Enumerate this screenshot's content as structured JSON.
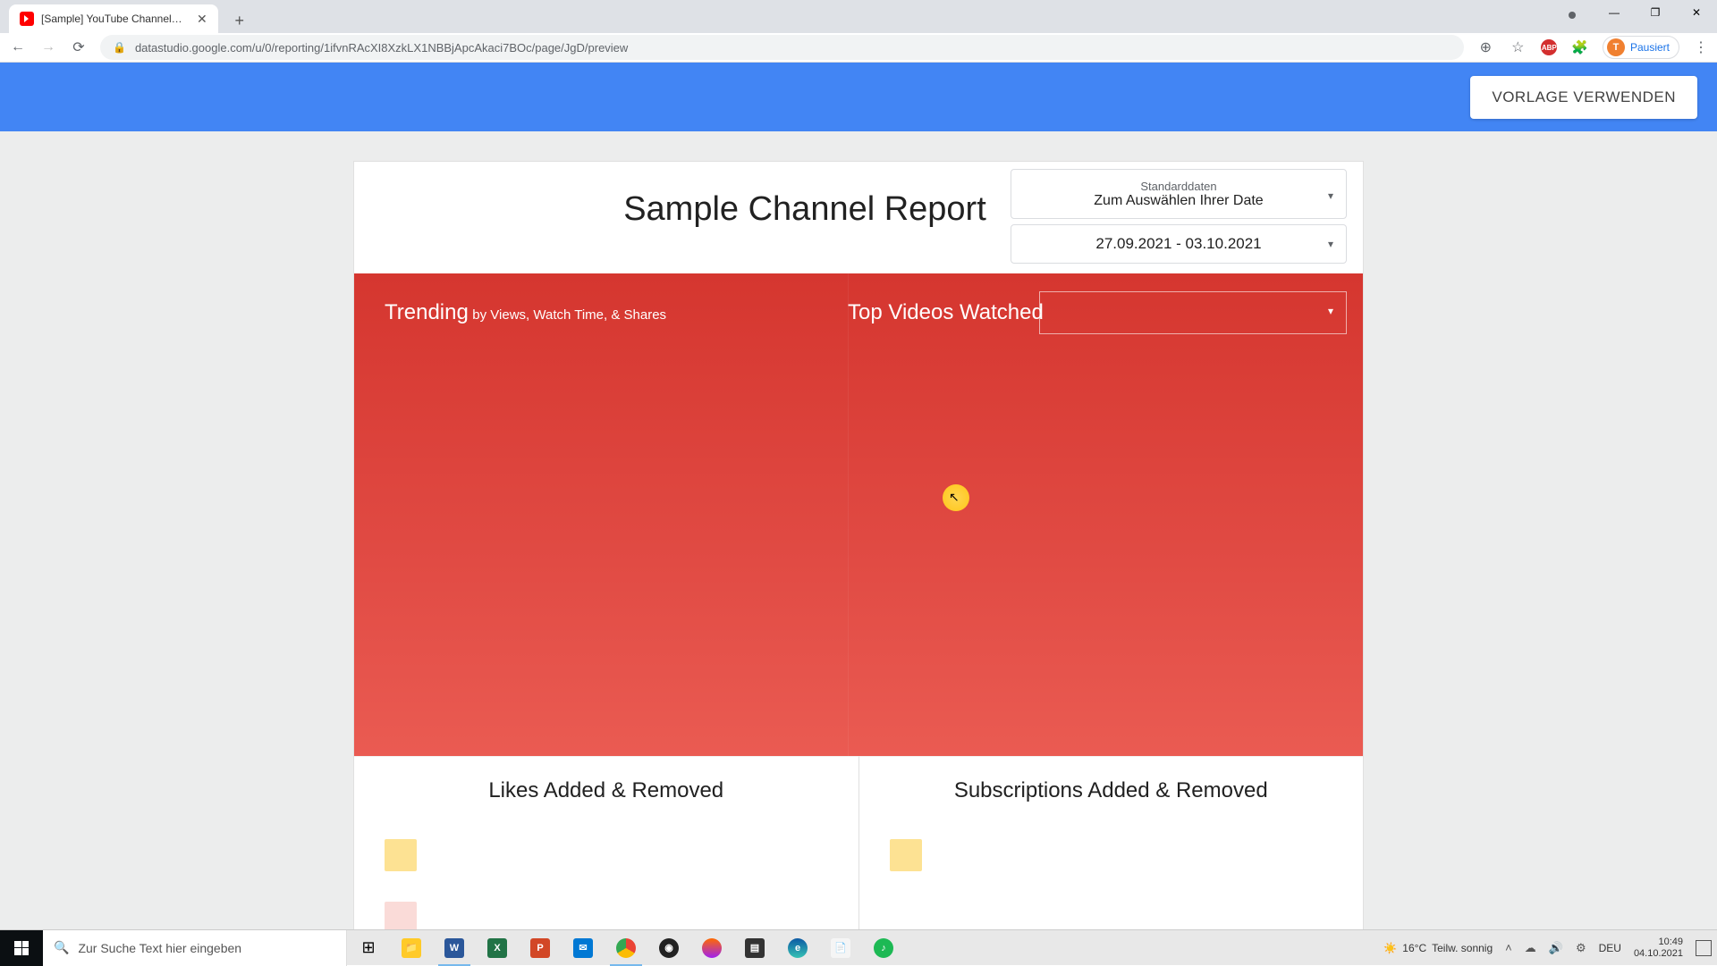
{
  "browser": {
    "tab_title": "[Sample] YouTube Channel Repo",
    "url": "datastudio.google.com/u/0/reporting/1ifvnRAcXI8XzkLX1NBBjApcAkaci7BOc/page/JgD/preview",
    "profile_label": "Pausiert",
    "profile_initial": "T",
    "ext_label": "ABP"
  },
  "header": {
    "use_template_button": "VORLAGE VERWENDEN"
  },
  "report": {
    "title": "Sample Channel Report",
    "data_source": {
      "label": "Standarddaten",
      "value": "Zum Auswählen Ihrer Date"
    },
    "date_range": "27.09.2021 - 03.10.2021",
    "trending": {
      "title": "Trending",
      "sub": "by Views, Watch Time, & Shares"
    },
    "top_videos": "Top Videos Watched",
    "likes_title": "Likes Added & Removed",
    "subs_title": "Subscriptions Added & Removed",
    "legend_colors": {
      "yellow": "#fde293",
      "red": "#f5b7b1"
    }
  },
  "taskbar": {
    "search_placeholder": "Zur Suche Text hier eingeben",
    "weather_temp": "16°C",
    "weather_desc": "Teilw. sonnig",
    "time": "10:49",
    "date": "04.10.2021",
    "lang": "DEU"
  }
}
